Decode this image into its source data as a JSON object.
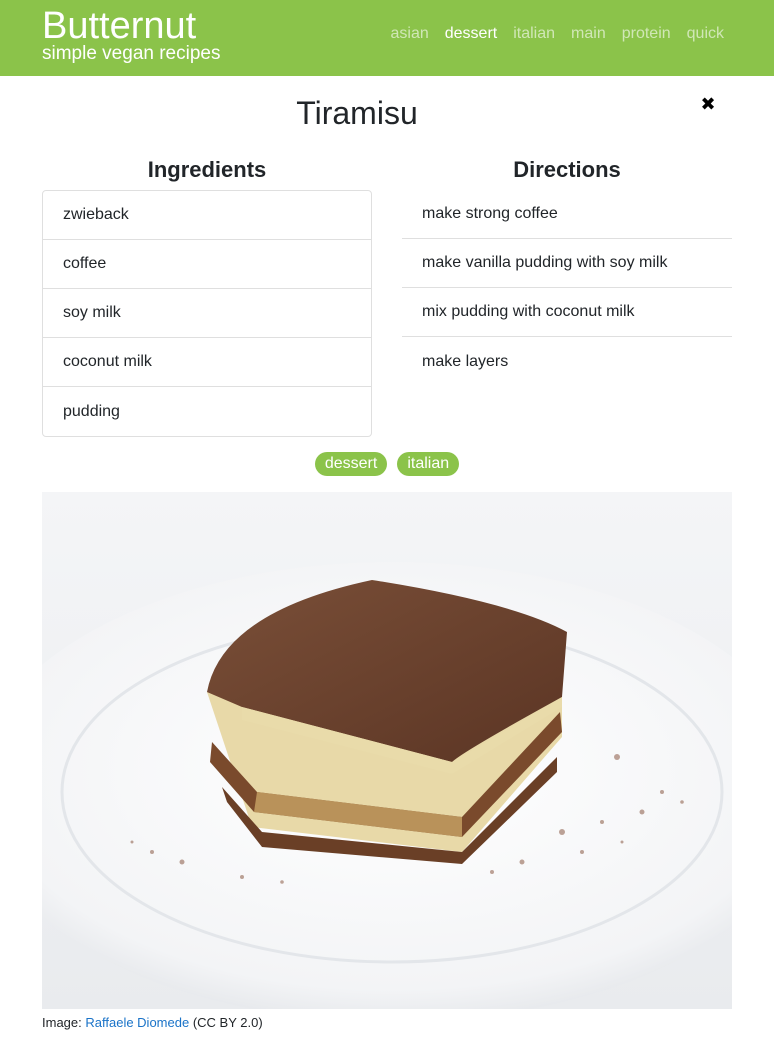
{
  "brand": {
    "name": "Butternut",
    "tagline": "simple vegan recipes"
  },
  "nav": {
    "items": [
      {
        "label": "asian"
      },
      {
        "label": "dessert"
      },
      {
        "label": "italian"
      },
      {
        "label": "main"
      },
      {
        "label": "protein"
      },
      {
        "label": "quick"
      }
    ],
    "active": "dessert"
  },
  "recipe": {
    "title": "Tiramisu",
    "close_icon": "close-icon",
    "ingredients_heading": "Ingredients",
    "directions_heading": "Directions",
    "ingredients": [
      "zwieback",
      "coffee",
      "soy milk",
      "coconut milk",
      "pudding"
    ],
    "directions": [
      "make strong coffee",
      "make vanilla pudding with soy milk",
      "mix pudding with coconut milk",
      "make layers"
    ],
    "tags": [
      "dessert",
      "italian"
    ]
  },
  "image_credit": {
    "prefix": "Image:",
    "author": "Raffaele Diomede",
    "license": "(CC BY 2.0)"
  },
  "colors": {
    "brand": "#8bc34a",
    "link": "#1a73c8"
  }
}
